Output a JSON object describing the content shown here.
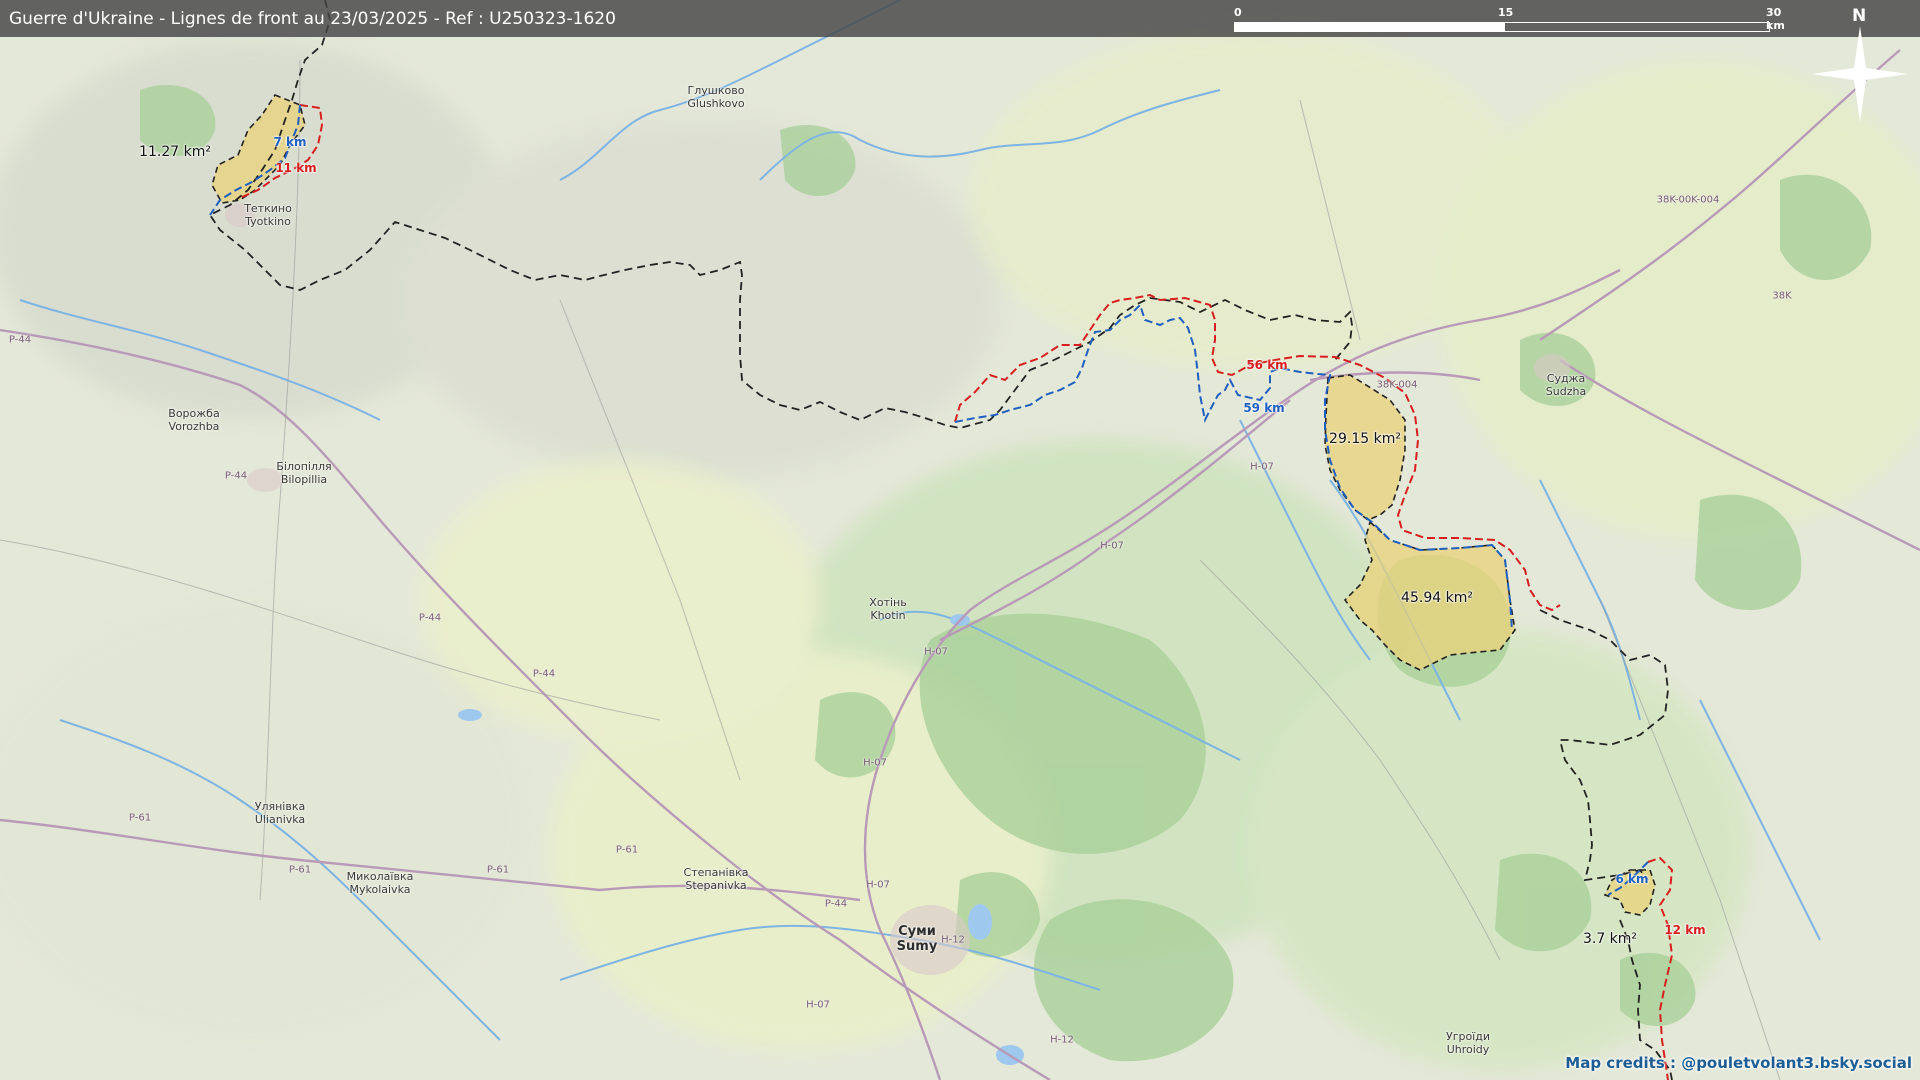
{
  "title": "Guerre d'Ukraine - Lignes de front au 23/03/2025 - Ref : U250323-1620",
  "scale_bar": {
    "labels": [
      "0",
      "15",
      "30 km"
    ]
  },
  "north_arrow": {
    "label": "N"
  },
  "credit": "Map credits : @pouletvolant3.bsky.social",
  "places": [
    {
      "id": "glushkovo",
      "name": "Глушково\nGlushkovo"
    },
    {
      "id": "tyotkino",
      "name": "Теткино\nTyotkino"
    },
    {
      "id": "vorozhba",
      "name": "Ворожба\nVorozhba"
    },
    {
      "id": "bilopillia",
      "name": "Білопілля\nBilopillia"
    },
    {
      "id": "khotin",
      "name": "Хотінь\nKhotin"
    },
    {
      "id": "sudzha",
      "name": "Суджа\nSudzha"
    },
    {
      "id": "ulianivka",
      "name": "Улянівка\nUlianivka"
    },
    {
      "id": "mykolaivka",
      "name": "Миколаївка\nMykolaivka"
    },
    {
      "id": "stepanivka",
      "name": "Степанівка\nStepanivka"
    },
    {
      "id": "sumy",
      "name": "Суми\nSumy"
    },
    {
      "id": "uhroidy",
      "name": "Угроїди\nUhroidy"
    }
  ],
  "areas": [
    {
      "id": "area-tyotkino",
      "label": "11.27 km²"
    },
    {
      "id": "area-north",
      "label": "29.15 km²"
    },
    {
      "id": "area-south",
      "label": "45.94 km²"
    },
    {
      "id": "area-southeast",
      "label": "3.7 km²"
    }
  ],
  "line_lengths": [
    {
      "id": "tyotkino-blue",
      "label": "7 km",
      "color": "#1f5fbf"
    },
    {
      "id": "tyotkino-red",
      "label": "11 km",
      "color": "#d81e1e"
    },
    {
      "id": "center-red",
      "label": "56 km",
      "color": "#d81e1e"
    },
    {
      "id": "center-blue",
      "label": "59 km",
      "color": "#1f5fbf"
    },
    {
      "id": "southeast-blue",
      "label": "6 km",
      "color": "#1f5fbf"
    },
    {
      "id": "southeast-red",
      "label": "12 km",
      "color": "#d81e1e"
    }
  ],
  "road_labels": [
    "P-44",
    "P-44",
    "P-44",
    "P-44",
    "P-61",
    "P-61",
    "P-61",
    "P-61",
    "H-07",
    "H-07",
    "H-07",
    "H-07",
    "H-07",
    "H-07",
    "H-12",
    "H-12",
    "38K-004",
    "38K-00K-004",
    "38K",
    "P-44"
  ],
  "legend_colors": {
    "border": "#222222",
    "red_line": "#d81e1e",
    "blue_line": "#1f5fbf",
    "occupied_fill": "#e9d27a"
  }
}
